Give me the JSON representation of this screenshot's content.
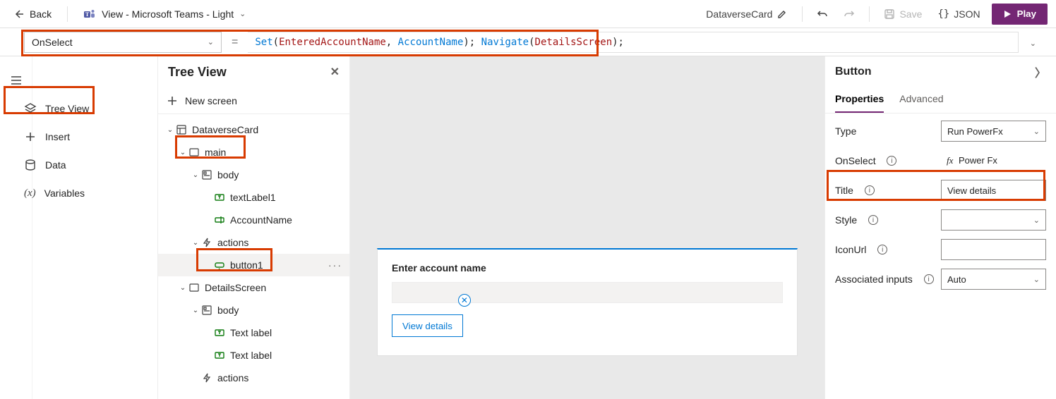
{
  "topbar": {
    "back": "Back",
    "view_label": "View - Microsoft Teams - Light",
    "app_name": "DataverseCard",
    "save": "Save",
    "json": "JSON",
    "play": "Play"
  },
  "formula": {
    "property": "OnSelect",
    "fn1": "Set",
    "arg1a": "EnteredAccountName",
    "arg1b": "AccountName",
    "fn2": "Navigate",
    "arg2": "DetailsScreen",
    "raw": "Set(EnteredAccountName, AccountName); Navigate(DetailsScreen);"
  },
  "leftnav": {
    "tree": "Tree View",
    "insert": "Insert",
    "data": "Data",
    "vars": "Variables"
  },
  "tree": {
    "title": "Tree View",
    "new_screen": "New screen",
    "items": [
      {
        "label": "DataverseCard"
      },
      {
        "label": "main"
      },
      {
        "label": "body"
      },
      {
        "label": "textLabel1"
      },
      {
        "label": "AccountName"
      },
      {
        "label": "actions"
      },
      {
        "label": "button1"
      },
      {
        "label": "DetailsScreen"
      },
      {
        "label": "body"
      },
      {
        "label": "Text label"
      },
      {
        "label": "Text label"
      },
      {
        "label": "actions"
      }
    ]
  },
  "card": {
    "title": "Enter account name",
    "button": "View details"
  },
  "props": {
    "header": "Button",
    "tab_props": "Properties",
    "tab_adv": "Advanced",
    "rows": {
      "type_label": "Type",
      "type_value": "Run PowerFx",
      "onselect_label": "OnSelect",
      "onselect_value": "Power Fx",
      "title_label": "Title",
      "title_value": "View details",
      "style_label": "Style",
      "iconurl_label": "IconUrl",
      "assoc_label": "Associated inputs",
      "assoc_value": "Auto"
    }
  }
}
